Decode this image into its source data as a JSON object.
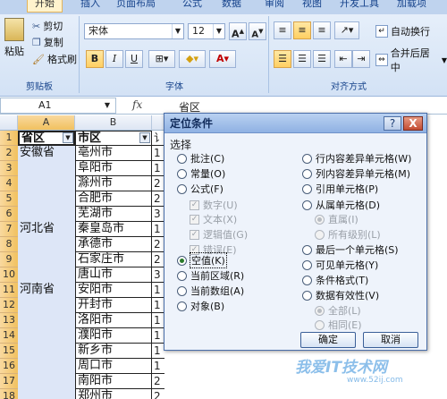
{
  "ribbon": {
    "tabs": [
      "开始",
      "插入",
      "页面布局",
      "公式",
      "数据",
      "审阅",
      "视图",
      "开发工具",
      "加载项"
    ],
    "clipboard": {
      "cut": "剪切",
      "copy": "复制",
      "paste": "粘贴",
      "format_painter": "格式刷",
      "group_label": "剪贴板"
    },
    "font": {
      "name": "宋体",
      "size": "12",
      "group_label": "字体",
      "bold": "B",
      "italic": "I",
      "underline": "U"
    },
    "alignment": {
      "wrap": "自动换行",
      "merge": "合并后居中",
      "group_label": "对齐方式"
    }
  },
  "formula_bar": {
    "name_box": "A1",
    "fx": "fx",
    "value": "省区"
  },
  "columns": [
    "A",
    "B"
  ],
  "rows": [
    "1",
    "2",
    "3",
    "4",
    "5",
    "6",
    "7",
    "8",
    "9",
    "10",
    "11",
    "12",
    "13",
    "14",
    "15",
    "16",
    "17",
    "18"
  ],
  "sheet": {
    "colA": [
      "省区",
      "安徽省",
      "",
      "",
      "",
      "",
      "河北省",
      "",
      "",
      "",
      "河南省",
      "",
      "",
      "",
      "",
      "",
      "",
      ""
    ],
    "colB": [
      "市区",
      "亳州市",
      "阜阳市",
      "滁州市",
      "合肥市",
      "芜湖市",
      "秦皇岛市",
      "承德市",
      "石家庄市",
      "唐山市",
      "安阳市",
      "开封市",
      "洛阳市",
      "濮阳市",
      "新乡市",
      "周口市",
      "南阳市",
      "郑州市"
    ],
    "colC": [
      "讠",
      "1",
      "1",
      "2",
      "2",
      "3",
      "1",
      "2",
      "2",
      "3",
      "1",
      "1",
      "1",
      "1",
      "1",
      "1",
      "2",
      "2"
    ]
  },
  "dialog": {
    "title": "定位条件",
    "help": "?",
    "close": "X",
    "section": "选择",
    "left": [
      {
        "label": "批注(C)",
        "type": "radio",
        "disabled": false,
        "checked": false
      },
      {
        "label": "常量(O)",
        "type": "radio",
        "disabled": false,
        "checked": false
      },
      {
        "label": "公式(F)",
        "type": "radio",
        "disabled": false,
        "checked": false
      },
      {
        "label": "数字(U)",
        "type": "check",
        "disabled": true,
        "checked": true
      },
      {
        "label": "文本(X)",
        "type": "check",
        "disabled": true,
        "checked": true
      },
      {
        "label": "逻辑值(G)",
        "type": "check",
        "disabled": true,
        "checked": true
      },
      {
        "label": "错误(E)",
        "type": "check",
        "disabled": true,
        "checked": true
      },
      {
        "label": "空值(K)",
        "type": "radio",
        "disabled": false,
        "checked": true
      },
      {
        "label": "当前区域(R)",
        "type": "radio",
        "disabled": false,
        "checked": false
      },
      {
        "label": "当前数组(A)",
        "type": "radio",
        "disabled": false,
        "checked": false
      },
      {
        "label": "对象(B)",
        "type": "radio",
        "disabled": false,
        "checked": false
      }
    ],
    "right": [
      {
        "label": "行内容差异单元格(W)",
        "type": "radio",
        "disabled": false,
        "checked": false
      },
      {
        "label": "列内容差异单元格(M)",
        "type": "radio",
        "disabled": false,
        "checked": false
      },
      {
        "label": "引用单元格(P)",
        "type": "radio",
        "disabled": false,
        "checked": false
      },
      {
        "label": "从属单元格(D)",
        "type": "radio",
        "disabled": false,
        "checked": false
      },
      {
        "label": "直属(I)",
        "type": "radio",
        "disabled": true,
        "checked": true
      },
      {
        "label": "所有级别(L)",
        "type": "radio",
        "disabled": true,
        "checked": false
      },
      {
        "label": "最后一个单元格(S)",
        "type": "radio",
        "disabled": false,
        "checked": false
      },
      {
        "label": "可见单元格(Y)",
        "type": "radio",
        "disabled": false,
        "checked": false
      },
      {
        "label": "条件格式(T)",
        "type": "radio",
        "disabled": false,
        "checked": false
      },
      {
        "label": "数据有效性(V)",
        "type": "radio",
        "disabled": false,
        "checked": false
      },
      {
        "label": "全部(L)",
        "type": "radio",
        "disabled": true,
        "checked": true
      },
      {
        "label": "相同(E)",
        "type": "radio",
        "disabled": true,
        "checked": false
      }
    ],
    "ok": "确定",
    "cancel": "取消"
  },
  "watermark": {
    "text": "我爱IT技术网",
    "url": "www.52ij.com"
  }
}
